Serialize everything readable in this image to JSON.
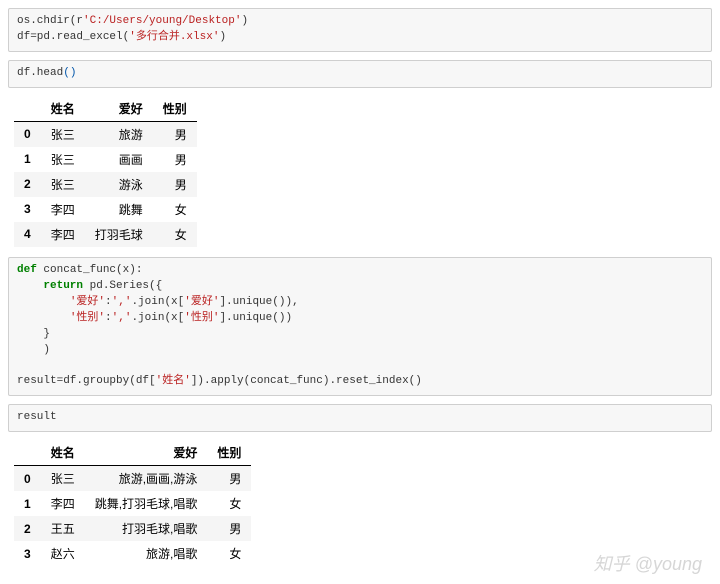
{
  "code_cell_1": {
    "line1_pre": "os.chdir(",
    "line1_prefix": "r",
    "line1_str": "'C:/Users/young/Desktop'",
    "line1_post": ")",
    "line2_pre": "df=pd.read_excel(",
    "line2_str": "'多行合并.xlsx'",
    "line2_post": ")"
  },
  "code_cell_2": "df.head()",
  "table1": {
    "headers": [
      "",
      "姓名",
      "爱好",
      "性别"
    ],
    "rows": [
      [
        "0",
        "张三",
        "旅游",
        "男"
      ],
      [
        "1",
        "张三",
        "画画",
        "男"
      ],
      [
        "2",
        "张三",
        "游泳",
        "男"
      ],
      [
        "3",
        "李四",
        "跳舞",
        "女"
      ],
      [
        "4",
        "李四",
        "打羽毛球",
        "女"
      ]
    ]
  },
  "code_cell_3": {
    "l1_def": "def",
    "l1_name": " concat_func(x):",
    "l2_ret": "    return",
    "l2_rest": " pd.Series({",
    "l3_pre": "        ",
    "l3_k": "'爱好'",
    "l3_mid": ":",
    "l3_sep": "','",
    "l3_join": ".join(x[",
    "l3_col": "'爱好'",
    "l3_end": "].unique()),",
    "l4_pre": "        ",
    "l4_k": "'性别'",
    "l4_mid": ":",
    "l4_sep": "','",
    "l4_join": ".join(x[",
    "l4_col": "'性别'",
    "l4_end": "].unique())",
    "l5": "    }",
    "l6": "    )",
    "l7": "",
    "l8_pre": "result=df.groupby(df[",
    "l8_col": "'姓名'",
    "l8_post": "]).apply(concat_func).reset_index()"
  },
  "code_cell_4": "result",
  "table2": {
    "headers": [
      "",
      "姓名",
      "爱好",
      "性别"
    ],
    "rows": [
      [
        "0",
        "张三",
        "旅游,画画,游泳",
        "男"
      ],
      [
        "1",
        "李四",
        "跳舞,打羽毛球,唱歌",
        "女"
      ],
      [
        "2",
        "王五",
        "打羽毛球,唱歌",
        "男"
      ],
      [
        "3",
        "赵六",
        "旅游,唱歌",
        "女"
      ]
    ]
  },
  "watermark": "知乎 @young"
}
